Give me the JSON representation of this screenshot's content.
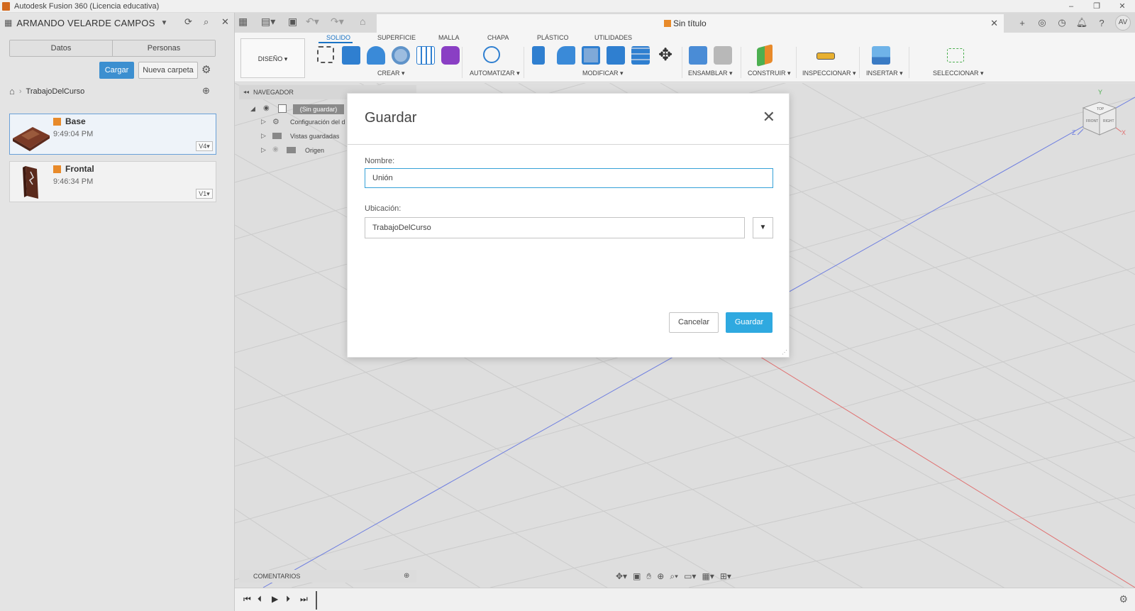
{
  "window": {
    "title": "Autodesk Fusion 360 (Licencia educativa)",
    "controls": [
      "–",
      "❐",
      "✕"
    ]
  },
  "data_panel": {
    "user": "ARMANDO VELARDE CAMPOS",
    "tabs": [
      "Datos",
      "Personas"
    ],
    "upload_label": "Cargar",
    "new_folder_label": "Nueva carpeta",
    "breadcrumb": "TrabajoDelCurso",
    "files": [
      {
        "name": "Base",
        "time": "9:49:04 PM",
        "version": "V4▾"
      },
      {
        "name": "Frontal",
        "time": "9:46:34 PM",
        "version": "V1▾"
      }
    ]
  },
  "document": {
    "tab_title": "Sin título"
  },
  "toolbar": {
    "workspace": "DISEÑO ▾",
    "tabs": [
      "SOLIDO",
      "SUPERFICIE",
      "MALLA",
      "CHAPA",
      "PLÁSTICO",
      "UTILIDADES"
    ],
    "active_tab": "SOLIDO",
    "groups": [
      "CREAR ▾",
      "AUTOMATIZAR ▾",
      "MODIFICAR ▾",
      "ENSAMBLAR ▾",
      "CONSTRUIR ▾",
      "INSPECCIONAR ▾",
      "INSERTAR ▾",
      "SELECCIONAR ▾"
    ]
  },
  "browser": {
    "title": "NAVEGADOR",
    "root": "(Sin guardar)",
    "items": [
      "Configuración del d",
      "Vistas guardadas",
      "Origen"
    ]
  },
  "comments_label": "COMENTARIOS",
  "dialog": {
    "title": "Guardar",
    "name_label": "Nombre:",
    "name_value": "Unión",
    "location_label": "Ubicación:",
    "location_value": "TrabajoDelCurso",
    "cancel_label": "Cancelar",
    "save_label": "Guardar"
  },
  "viewcube": {
    "labels": [
      "TOP",
      "FRONT",
      "RIGHT"
    ],
    "axes": [
      "Y",
      "Z",
      "X"
    ]
  },
  "colors": {
    "accent": "#2fa9e0",
    "primary_button": "#3c8fd0",
    "active_tab": "#1a73c4"
  }
}
